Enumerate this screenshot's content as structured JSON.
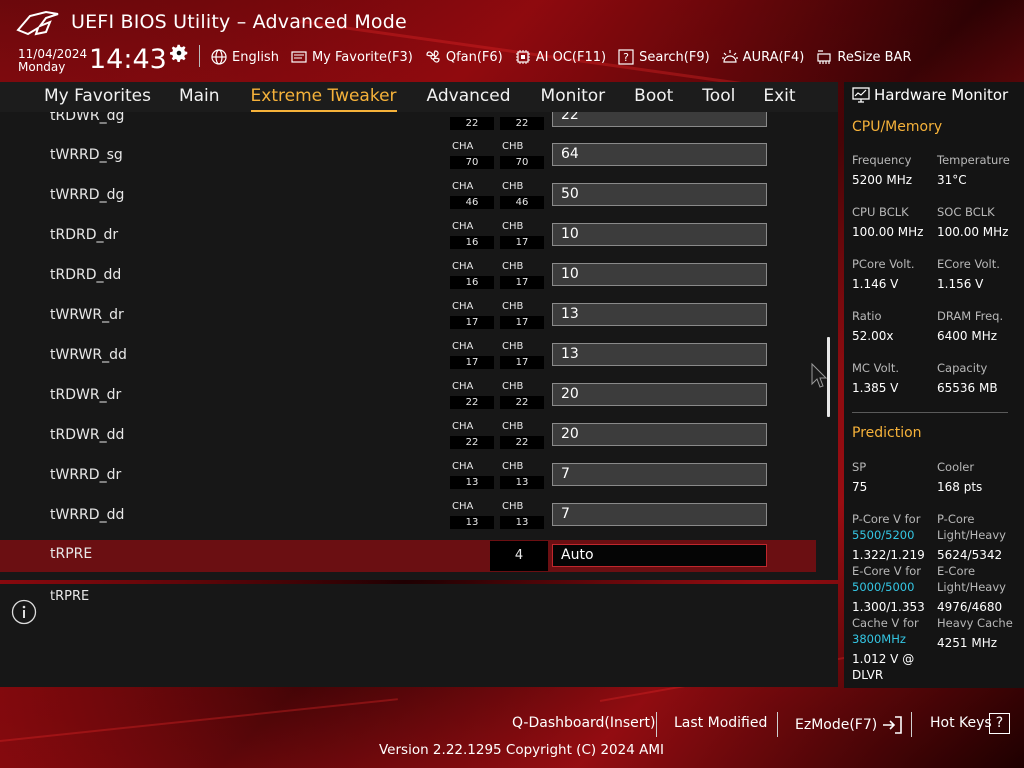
{
  "header": {
    "title": "UEFI BIOS Utility – Advanced Mode",
    "date": "11/04/2024",
    "day": "Monday",
    "time": "14:43",
    "tools": [
      {
        "label": "English",
        "icon": "globe-icon"
      },
      {
        "label": "My Favorite(F3)",
        "icon": "favorite-icon"
      },
      {
        "label": "Qfan(F6)",
        "icon": "fan-icon"
      },
      {
        "label": "AI OC(F11)",
        "icon": "ai-oc-icon"
      },
      {
        "label": "Search(F9)",
        "icon": "search-icon"
      },
      {
        "label": "AURA(F4)",
        "icon": "aura-icon"
      },
      {
        "label": "ReSize BAR",
        "icon": "resize-bar-icon"
      }
    ]
  },
  "nav": {
    "tabs": [
      "My Favorites",
      "Main",
      "Extreme Tweaker",
      "Advanced",
      "Monitor",
      "Boot",
      "Tool",
      "Exit"
    ],
    "active": "Extreme Tweaker"
  },
  "list": {
    "channel_a": "CHA",
    "channel_b": "CHB",
    "rows": [
      {
        "label": "tRDWR_dg",
        "cha": "22",
        "chb": "22",
        "value": "22"
      },
      {
        "label": "tWRRD_sg",
        "cha": "70",
        "chb": "70",
        "value": "64"
      },
      {
        "label": "tWRRD_dg",
        "cha": "46",
        "chb": "46",
        "value": "50"
      },
      {
        "label": "tRDRD_dr",
        "cha": "16",
        "chb": "17",
        "value": "10"
      },
      {
        "label": "tRDRD_dd",
        "cha": "16",
        "chb": "17",
        "value": "10"
      },
      {
        "label": "tWRWR_dr",
        "cha": "17",
        "chb": "17",
        "value": "13"
      },
      {
        "label": "tWRWR_dd",
        "cha": "17",
        "chb": "17",
        "value": "13"
      },
      {
        "label": "tRDWR_dr",
        "cha": "22",
        "chb": "22",
        "value": "20"
      },
      {
        "label": "tRDWR_dd",
        "cha": "22",
        "chb": "22",
        "value": "20"
      },
      {
        "label": "tWRRD_dr",
        "cha": "13",
        "chb": "13",
        "value": "7"
      },
      {
        "label": "tWRRD_dd",
        "cha": "13",
        "chb": "13",
        "value": "7"
      }
    ],
    "selected": {
      "label": "tRPRE",
      "current": "4",
      "value": "Auto"
    }
  },
  "help": {
    "text": "tRPRE"
  },
  "hardware_monitor": {
    "title": "Hardware Monitor",
    "cpu_memory": {
      "heading": "CPU/Memory",
      "items": [
        {
          "label": "Frequency",
          "value": "5200 MHz"
        },
        {
          "label": "Temperature",
          "value": "31°C"
        },
        {
          "label": "CPU BCLK",
          "value": "100.00 MHz"
        },
        {
          "label": "SOC BCLK",
          "value": "100.00 MHz"
        },
        {
          "label": "PCore Volt.",
          "value": "1.146 V"
        },
        {
          "label": "ECore Volt.",
          "value": "1.156 V"
        },
        {
          "label": "Ratio",
          "value": "52.00x"
        },
        {
          "label": "DRAM Freq.",
          "value": "6400 MHz"
        },
        {
          "label": "MC Volt.",
          "value": "1.385 V"
        },
        {
          "label": "Capacity",
          "value": "65536 MB"
        }
      ]
    },
    "prediction": {
      "heading": "Prediction",
      "sp_label": "SP",
      "sp_value": "75",
      "cooler_label": "Cooler",
      "cooler_value": "168 pts",
      "pcore_label": "P-Core V for",
      "pcore_freq": "5500/5200",
      "pcore_value": "1.322/1.219",
      "pcore_lh_label1": "P-Core",
      "pcore_lh_label2": "Light/Heavy",
      "pcore_lh_value": "5624/5342",
      "ecore_label": "E-Core V for",
      "ecore_freq": "5000/5000",
      "ecore_value": "1.300/1.353",
      "ecore_lh_label1": "E-Core",
      "ecore_lh_label2": "Light/Heavy",
      "ecore_lh_value": "4976/4680",
      "cache_label": "Cache V for",
      "cache_freq": "3800MHz",
      "cache_value1": "1.012 V @",
      "cache_value2": "DLVR",
      "heavy_cache_label": "Heavy Cache",
      "heavy_cache_value": "4251 MHz"
    }
  },
  "footer": {
    "qdashboard": "Q-Dashboard(Insert)",
    "last_modified": "Last Modified",
    "ezmode": "EzMode(F7)",
    "hotkeys": "Hot Keys",
    "hotkeys_key": "?",
    "version": "Version 2.22.1295 Copyright (C) 2024 AMI"
  },
  "colors": {
    "accent": "#f6b23a",
    "selected_row": "#6b0f12",
    "cyan": "#34c6e3"
  }
}
